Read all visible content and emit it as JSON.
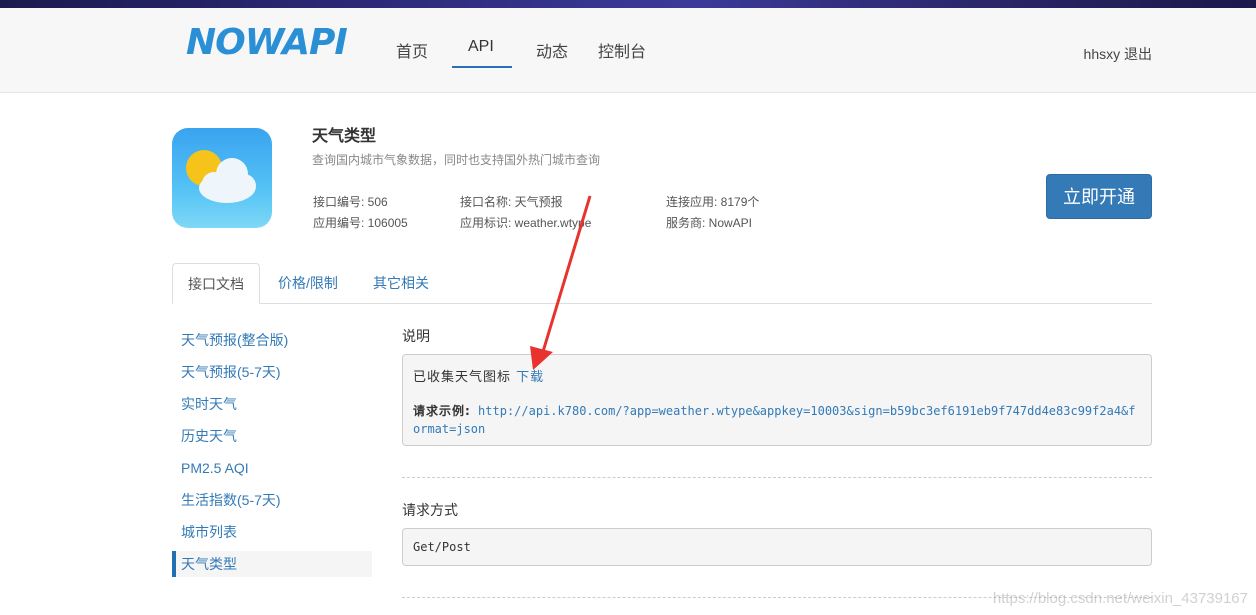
{
  "header": {
    "logo": "NOWAPI",
    "nav": [
      "首页",
      "API",
      "动态",
      "控制台"
    ],
    "active_nav": "API",
    "user": {
      "name": "hhsxy",
      "logout": "退出"
    }
  },
  "api": {
    "title": "天气类型",
    "subtitle": "查询国内城市气象数据，同时也支持国外热门城市查询",
    "meta": {
      "interface_no": "接口编号: 506",
      "app_no": "应用编号: 106005",
      "interface_name": "接口名称: 天气预报",
      "app_id": "应用标识: weather.wtype",
      "connected_apps": "连接应用: 8179个",
      "provider": "服务商: NowAPI"
    },
    "cta": "立即开通"
  },
  "tabs": [
    "接口文档",
    "价格/限制",
    "其它相关"
  ],
  "sidebar": {
    "items": [
      "天气预报(整合版)",
      "天气预报(5-7天)",
      "实时天气",
      "历史天气",
      "PM2.5 AQI",
      "生活指数(5-7天)",
      "城市列表",
      "天气类型"
    ],
    "active": "天气类型"
  },
  "doc": {
    "desc_label": "说明",
    "icons_text": "已收集天气图标",
    "download": "下载",
    "example_label": "请求示例:",
    "example_url_line1": "http://api.k780.com/?app=weather.wtype&appkey=10003&sign=b59bc3ef6191eb9f747dd4e83c99f2a4&f",
    "example_url_line2": "ormat=json",
    "method_label": "请求方式",
    "method_value": "Get/Post"
  },
  "watermark": "https://blog.csdn.net/weixin_43739167",
  "colors": {
    "accent": "#337ab7",
    "logo": "#2a8fd4",
    "arrow": "#e8322e"
  }
}
